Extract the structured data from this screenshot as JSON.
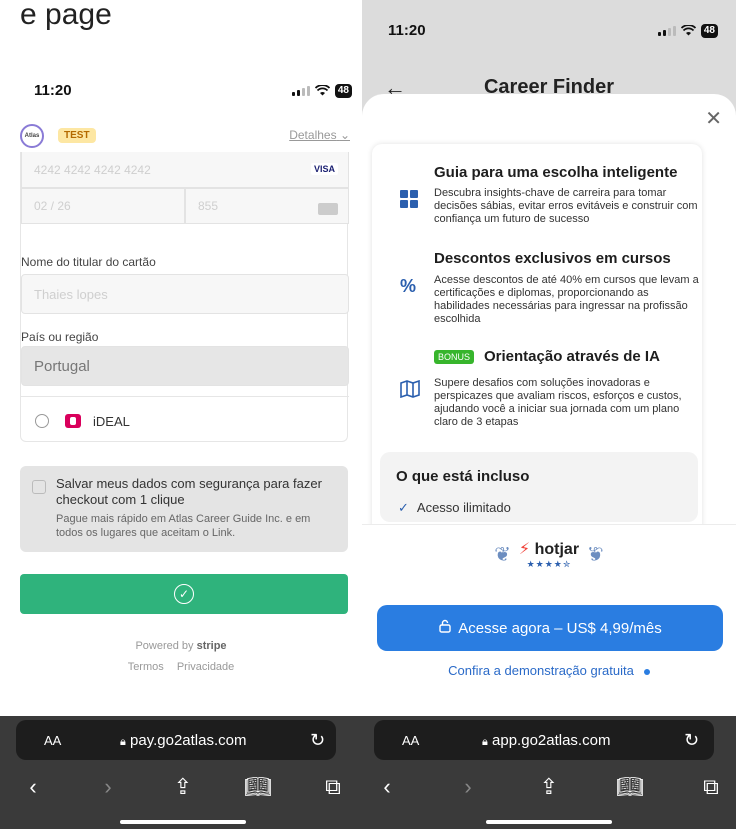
{
  "caption": "e page",
  "left": {
    "status": {
      "time": "11:20",
      "battery": "48"
    },
    "brand_logo_text": "Atlas",
    "test_badge": "TEST",
    "details_link": "Detalhes",
    "card_number_placeholder": "4242 4242 4242 4242",
    "card_brand": "VISA",
    "expiry_placeholder": "02 / 26",
    "cvc_placeholder": "855",
    "holder_label": "Nome do titular do cartão",
    "holder_placeholder": "Thaies lopes",
    "country_label": "País ou região",
    "country_value": "Portugal",
    "ideal_label": "iDEAL",
    "save": {
      "title": "Salvar meus dados com segurança para fazer checkout com 1 clique",
      "subtitle": "Pague mais rápido em Atlas Career Guide Inc. e em todos os lugares que aceitam o Link."
    },
    "powered_by": "Powered by",
    "stripe": "stripe",
    "terms": "Termos",
    "privacy": "Privacidade",
    "safari": {
      "aa": "AA",
      "url": "pay.go2atlas.com"
    }
  },
  "right": {
    "status": {
      "time": "11:20",
      "battery": "48"
    },
    "title": "Career Finder",
    "features": [
      {
        "title": "Guia para uma escolha inteligente",
        "description": "Descubra insights-chave de carreira para tomar decisões sábias, evitar erros evitáveis e construir com confiança um futuro de sucesso"
      },
      {
        "title": "Descontos exclusivos em cursos",
        "description": "Acesse descontos de até 40% em cursos que levam a certificações e diplomas, proporcionando as habilidades necessárias para ingressar na profissão escolhida"
      },
      {
        "badge": "BONUS",
        "title": "Orientação através de IA",
        "description": "Supere desafios com soluções inovadoras e perspicazes que avaliam riscos, esforços e custos, ajudando você a iniciar sua jornada com um plano claro de 3 etapas"
      }
    ],
    "included": {
      "title": "O que está incluso",
      "item": "Acesso ilimitado"
    },
    "hotjar": {
      "name": "hotjar",
      "rating": 4.5
    },
    "cta": "Acesse agora – US$ 4,99/mês",
    "demo_link": "Confira a demonstração gratuita",
    "safari": {
      "aa": "AA",
      "url": "app.go2atlas.com"
    }
  }
}
